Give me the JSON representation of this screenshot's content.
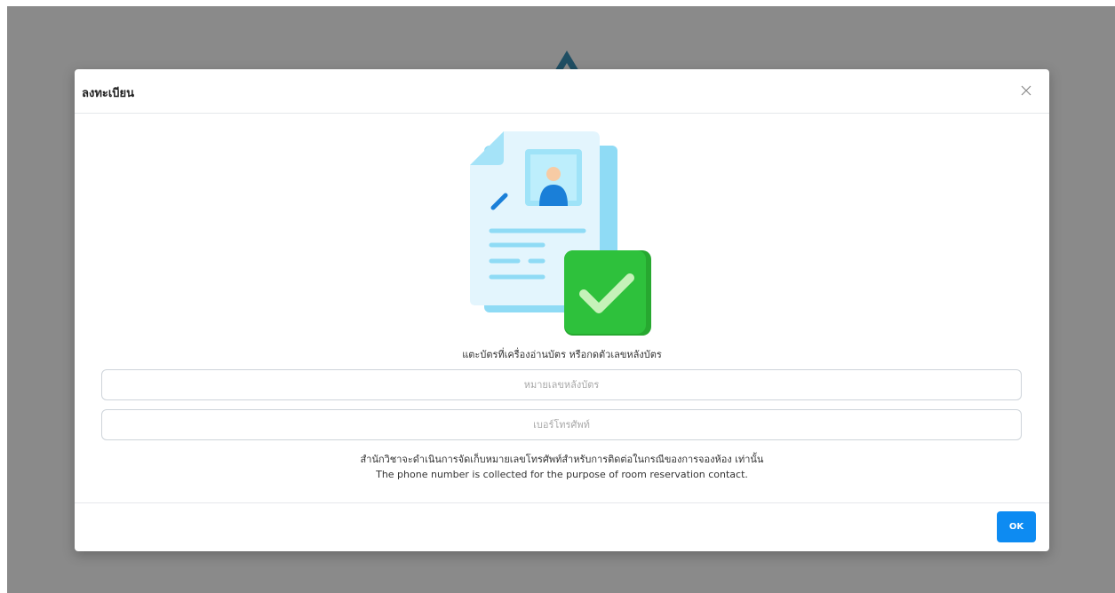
{
  "modal": {
    "title": "ลงทะเบียน",
    "close_icon": "close-icon"
  },
  "illustration": {
    "icon": "id-card-verified-icon"
  },
  "instruction": "แตะบัตรที่เครื่องอ่านบัตร หรือกดตัวเลขหลังบัตร",
  "fields": {
    "card_number": {
      "placeholder": "หมายเลขหลังบัตร",
      "value": ""
    },
    "phone_number": {
      "placeholder": "เบอร์โทรศัพท์",
      "value": ""
    }
  },
  "notice": {
    "thai": "สำนักวิชาจะดำเนินการจัดเก็บหมายเลขโทรศัพท์สำหรับการติดต่อในกรณีของการจองห้อง เท่านั้น",
    "english": "The phone number is collected for the purpose of room reservation contact."
  },
  "footer": {
    "ok_label": "OK"
  },
  "colors": {
    "backdrop": "#8a8a8a",
    "primary": "#0d8bf2",
    "check_green": "#2ec13c",
    "document_blue": "#bde9fa"
  }
}
